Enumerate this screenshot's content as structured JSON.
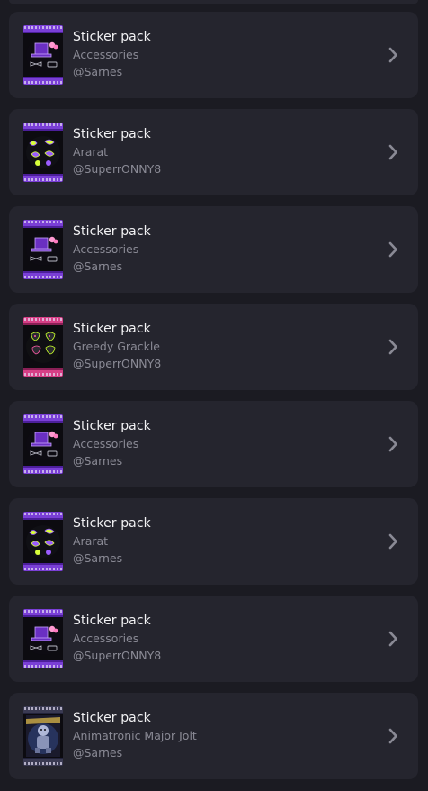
{
  "list": {
    "items": [
      {
        "title": "Sticker pack",
        "name": "Accessories",
        "author": "@Sarnes",
        "art": "accessories"
      },
      {
        "title": "Sticker pack",
        "name": "Ararat",
        "author": "@SuperrONNY8",
        "art": "ararat"
      },
      {
        "title": "Sticker pack",
        "name": "Accessories",
        "author": "@Sarnes",
        "art": "accessories"
      },
      {
        "title": "Sticker pack",
        "name": "Greedy Grackle",
        "author": "@SuperrONNY8",
        "art": "grackle"
      },
      {
        "title": "Sticker pack",
        "name": "Accessories",
        "author": "@Sarnes",
        "art": "accessories"
      },
      {
        "title": "Sticker pack",
        "name": "Ararat",
        "author": "@Sarnes",
        "art": "ararat"
      },
      {
        "title": "Sticker pack",
        "name": "Accessories",
        "author": "@SuperrONNY8",
        "art": "accessories"
      },
      {
        "title": "Sticker pack",
        "name": "Animatronic Major Jolt",
        "author": "@Sarnes",
        "art": "jolt"
      }
    ]
  },
  "icons": {
    "chevron": "chevron-right-icon"
  },
  "colors": {
    "background": "#1b1b22",
    "card": "#25252e",
    "title": "#f2f2f4",
    "subtitle": "#8a8a95",
    "chevron": "#8a8a95"
  }
}
